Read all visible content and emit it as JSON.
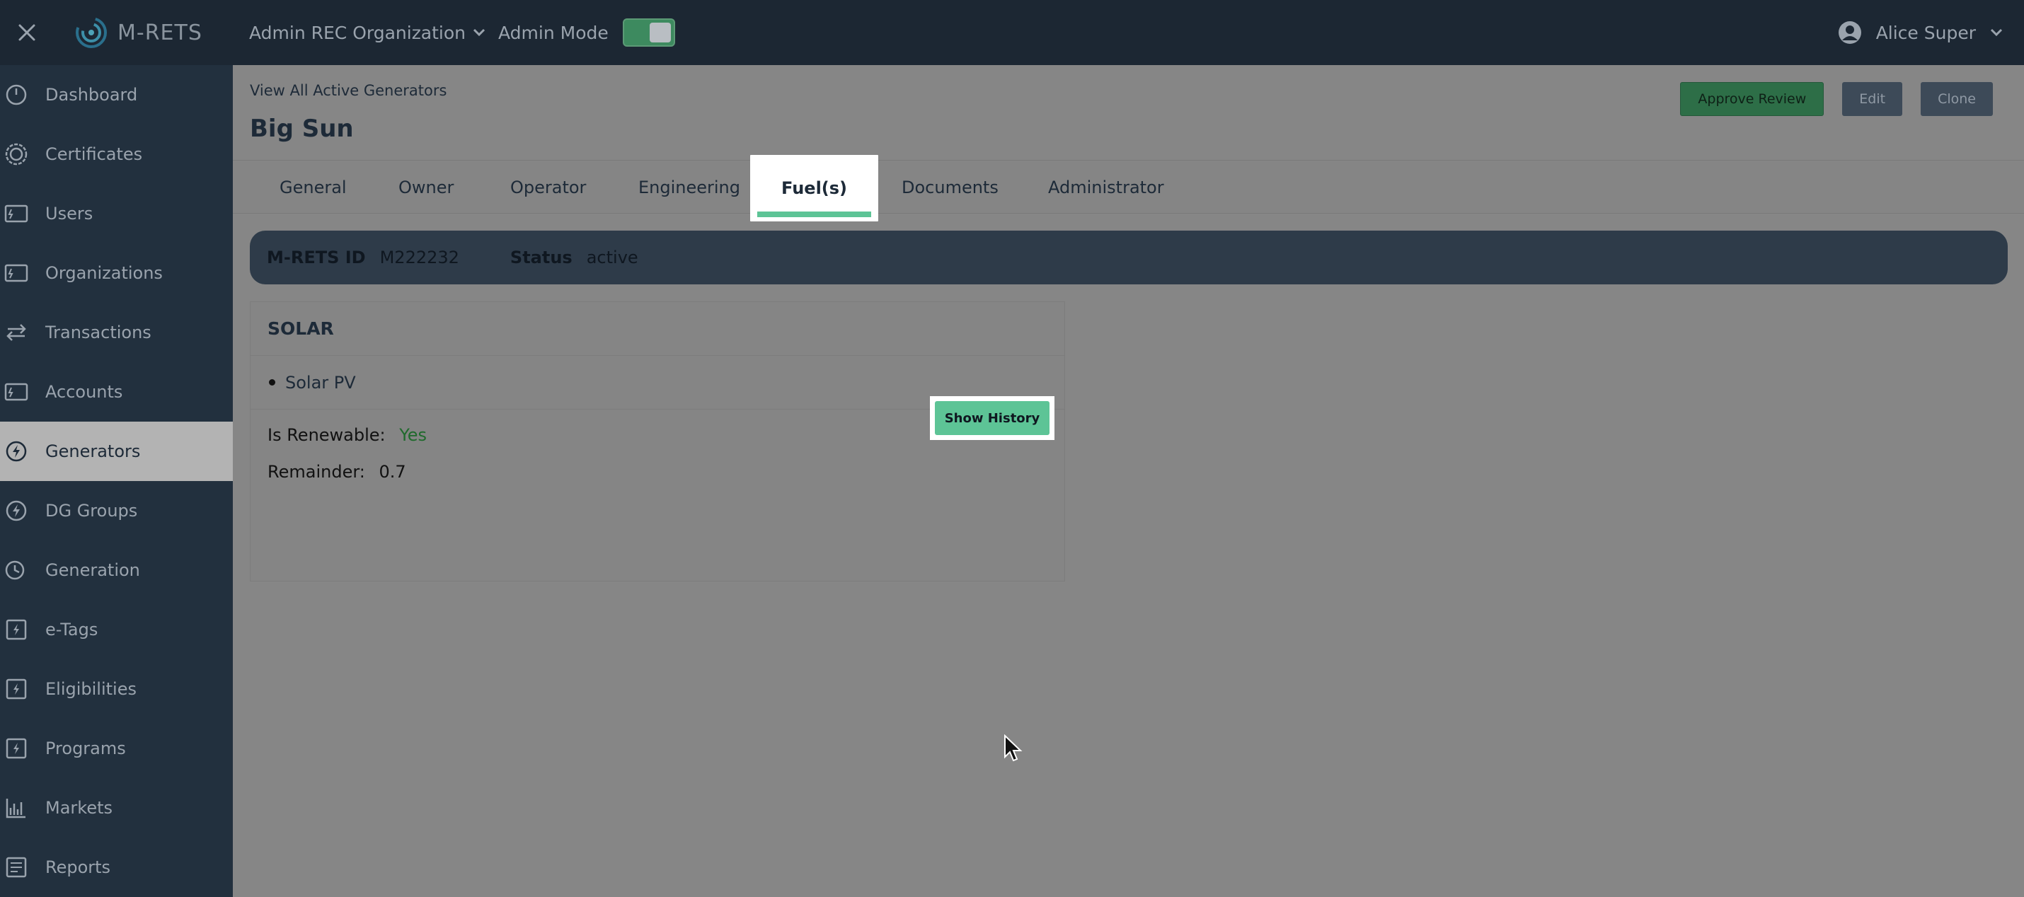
{
  "header": {
    "brand": "M-RETS",
    "org_name": "Admin REC Organization",
    "admin_mode_label": "Admin Mode",
    "admin_mode_on": true,
    "user_name": "Alice Super"
  },
  "sidebar": {
    "items": [
      {
        "label": "Dashboard",
        "icon": "gauge-icon"
      },
      {
        "label": "Certificates",
        "icon": "badge-icon"
      },
      {
        "label": "Users",
        "icon": "card-icon"
      },
      {
        "label": "Organizations",
        "icon": "card-icon"
      },
      {
        "label": "Transactions",
        "icon": "arrows-icon"
      },
      {
        "label": "Accounts",
        "icon": "card-icon"
      },
      {
        "label": "Generators",
        "icon": "bolt-circle-icon",
        "active": true
      },
      {
        "label": "DG Groups",
        "icon": "bolt-circle-icon"
      },
      {
        "label": "Generation",
        "icon": "clock-icon"
      },
      {
        "label": "e-Tags",
        "icon": "bolt-square-icon"
      },
      {
        "label": "Eligibilities",
        "icon": "bolt-square-icon"
      },
      {
        "label": "Programs",
        "icon": "bolt-square-icon"
      },
      {
        "label": "Markets",
        "icon": "chart-icon"
      },
      {
        "label": "Reports",
        "icon": "report-icon"
      }
    ]
  },
  "main": {
    "breadcrumb": "View All Active Generators",
    "title": "Big Sun",
    "actions": {
      "approve": "Approve Review",
      "edit": "Edit",
      "clone": "Clone"
    },
    "tabs": [
      "General",
      "Owner",
      "Operator",
      "Engineering",
      "Fuel(s)",
      "Documents",
      "Administrator"
    ],
    "active_tab": "Fuel(s)",
    "info": {
      "id_label": "M-RETS ID",
      "id_value": "M222232",
      "status_label": "Status",
      "status_value": "active"
    },
    "fuel": {
      "name": "SOLAR",
      "types": [
        "Solar PV"
      ],
      "renewable_label": "Is Renewable:",
      "renewable_value": "Yes",
      "remainder_label": "Remainder:",
      "remainder_value": "0.7",
      "history_button": "Show History"
    }
  },
  "colors": {
    "topbar": "#1c2733",
    "sidebar": "#22303e",
    "accent_green": "#5dc496",
    "overlay_gray": "#868686"
  }
}
